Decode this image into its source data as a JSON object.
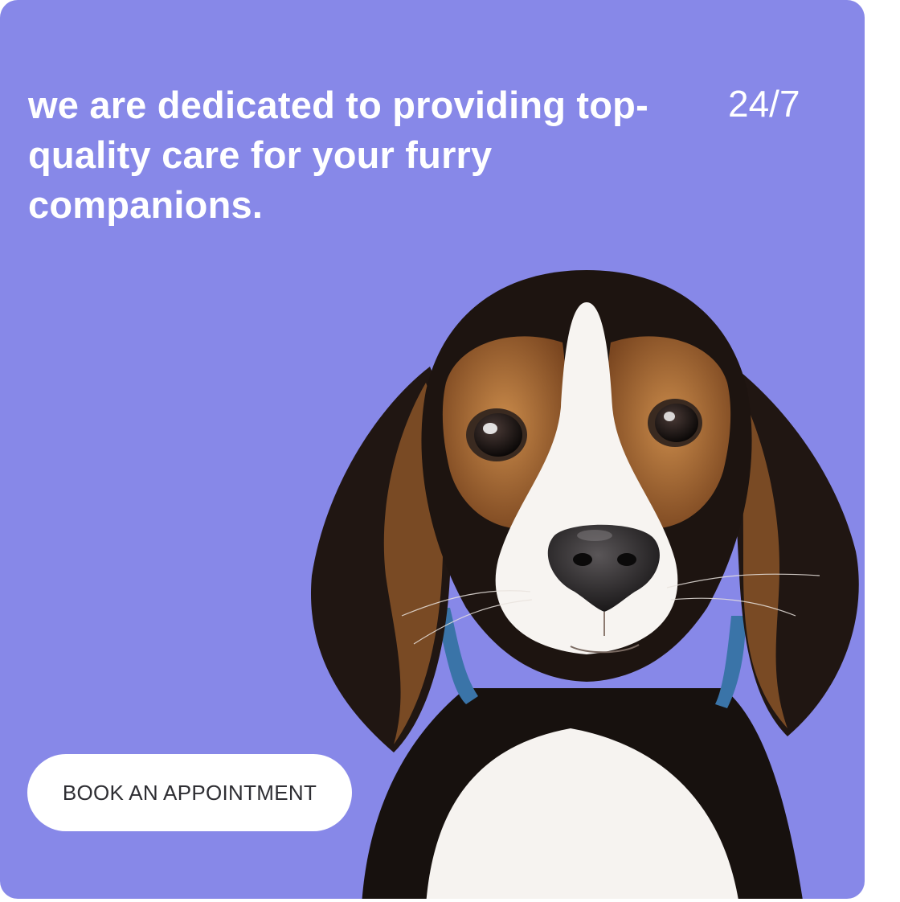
{
  "hero": {
    "headline": "we are dedicated to providing top-quality care for your furry companions.",
    "availability": "24/7",
    "cta_label": "BOOK AN APPOINTMENT",
    "image_subject": "beagle-puppy"
  },
  "colors": {
    "card_background": "#8788e8",
    "text": "#ffffff",
    "button_background": "#ffffff",
    "button_text": "#2e2e33"
  }
}
